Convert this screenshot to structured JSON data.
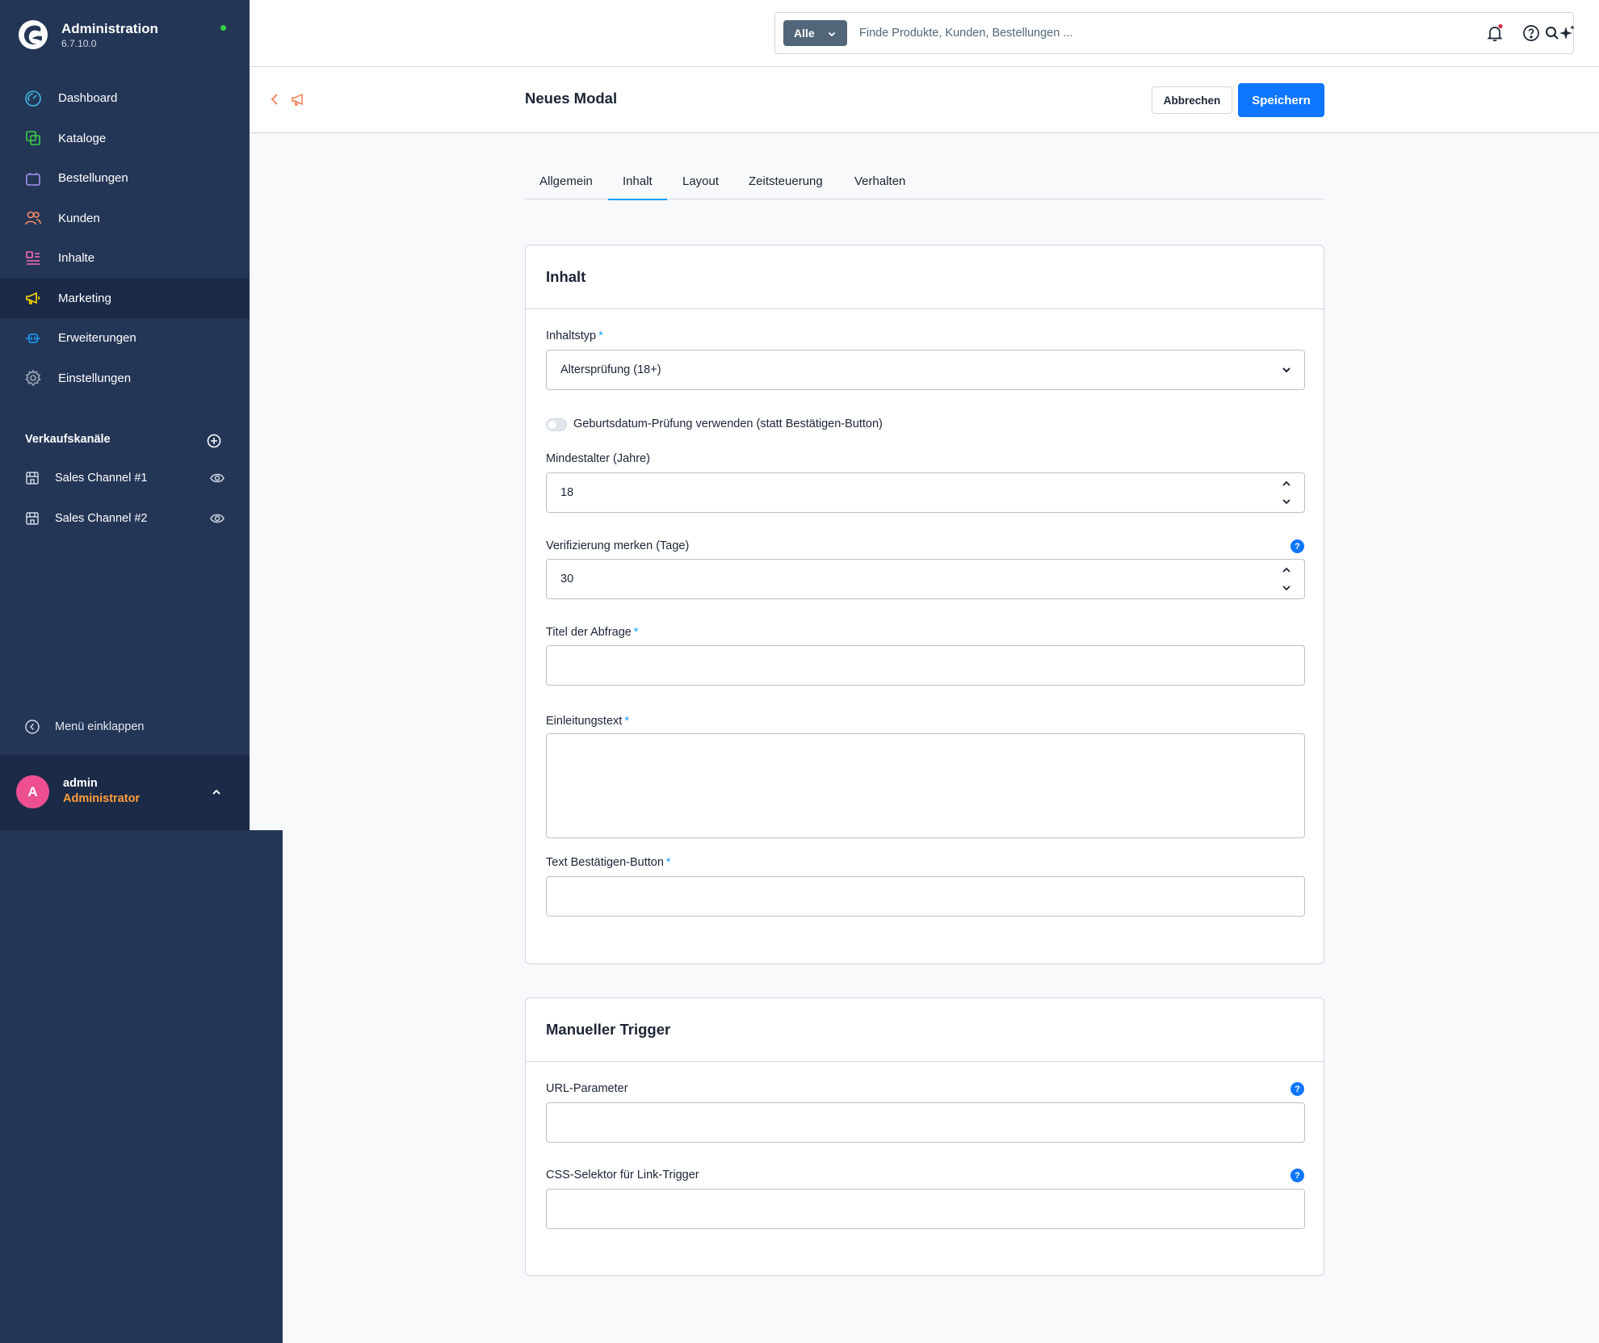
{
  "app": {
    "title": "Administration",
    "version": "6.7.10.0"
  },
  "colors": {
    "sidebar": "#243656",
    "accent": "#0f76ff",
    "role": "#ff9e3b",
    "status_online": "#37d046"
  },
  "nav": [
    {
      "label": "Dashboard",
      "icon": "dashboard-icon"
    },
    {
      "label": "Kataloge",
      "icon": "catalog-icon"
    },
    {
      "label": "Bestellungen",
      "icon": "orders-icon"
    },
    {
      "label": "Kunden",
      "icon": "customers-icon"
    },
    {
      "label": "Inhalte",
      "icon": "content-icon"
    },
    {
      "label": "Marketing",
      "icon": "megaphone-icon",
      "active": true
    },
    {
      "label": "Erweiterungen",
      "icon": "plug-icon"
    },
    {
      "label": "Einstellungen",
      "icon": "gear-icon"
    }
  ],
  "sales_channels": {
    "title": "Verkaufskanäle",
    "items": [
      {
        "label": "Sales Channel #1"
      },
      {
        "label": "Sales Channel #2"
      }
    ]
  },
  "collapse_label": "Menü einklappen",
  "user": {
    "initial": "A",
    "name": "admin",
    "role": "Administrator"
  },
  "search": {
    "filter_label": "Alle",
    "placeholder": "Finde Produkte, Kunden, Bestellungen ..."
  },
  "smartbar": {
    "title": "Neues Modal",
    "cancel_label": "Abbrechen",
    "save_label": "Speichern"
  },
  "tabs": [
    {
      "label": "Allgemein"
    },
    {
      "label": "Inhalt",
      "active": true
    },
    {
      "label": "Layout"
    },
    {
      "label": "Zeitsteuerung"
    },
    {
      "label": "Verhalten"
    }
  ],
  "content_card": {
    "title": "Inhalt",
    "content_type": {
      "label": "Inhaltstyp",
      "required_mark": "*",
      "value": "Altersprüfung (18+)"
    },
    "birthdate_toggle": {
      "label": "Geburtsdatum-Prüfung verwenden (statt Bestätigen-Button)",
      "checked": false
    },
    "min_age": {
      "label": "Mindestalter (Jahre)",
      "value": "18"
    },
    "remember": {
      "label": "Verifizierung merken (Tage)",
      "value": "30",
      "help": "?"
    },
    "query_title": {
      "label": "Titel der Abfrage",
      "required_mark": "*",
      "value": ""
    },
    "intro": {
      "label": "Einleitungstext",
      "required_mark": "*",
      "value": ""
    },
    "confirm_text": {
      "label": "Text Bestätigen-Button",
      "required_mark": "*",
      "value": ""
    }
  },
  "trigger_card": {
    "title": "Manueller Trigger",
    "url_param": {
      "label": "URL-Parameter",
      "value": "",
      "help": "?"
    },
    "css_selector": {
      "label": "CSS-Selektor für Link-Trigger",
      "value": "",
      "help": "?"
    }
  }
}
